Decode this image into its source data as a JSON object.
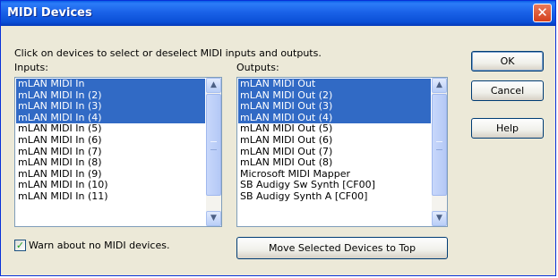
{
  "window": {
    "title": "MIDI Devices",
    "close_glyph": "✕",
    "instruction": "Click on devices to select or deselect MIDI inputs and outputs."
  },
  "inputs": {
    "label": "Inputs:",
    "items": [
      {
        "label": "mLAN MIDI In",
        "selected": true
      },
      {
        "label": "mLAN MIDI In (2)",
        "selected": true
      },
      {
        "label": "mLAN MIDI In (3)",
        "selected": true
      },
      {
        "label": "mLAN MIDI In (4)",
        "selected": true
      },
      {
        "label": "mLAN MIDI In (5)",
        "selected": false
      },
      {
        "label": "mLAN MIDI In (6)",
        "selected": false
      },
      {
        "label": "mLAN MIDI In (7)",
        "selected": false
      },
      {
        "label": "mLAN MIDI In (8)",
        "selected": false
      },
      {
        "label": "mLAN MIDI In (9)",
        "selected": false
      },
      {
        "label": "mLAN MIDI In (10)",
        "selected": false
      },
      {
        "label": "mLAN MIDI In (11)",
        "selected": false
      }
    ]
  },
  "outputs": {
    "label": "Outputs:",
    "items": [
      {
        "label": "mLAN MIDI Out",
        "selected": true
      },
      {
        "label": "mLAN MIDI Out (2)",
        "selected": true
      },
      {
        "label": "mLAN MIDI Out (3)",
        "selected": true
      },
      {
        "label": "mLAN MIDI Out (4)",
        "selected": true
      },
      {
        "label": "mLAN MIDI Out (5)",
        "selected": false
      },
      {
        "label": "mLAN MIDI Out (6)",
        "selected": false
      },
      {
        "label": "mLAN MIDI Out (7)",
        "selected": false
      },
      {
        "label": "mLAN MIDI Out (8)",
        "selected": false
      },
      {
        "label": "Microsoft MIDI Mapper",
        "selected": false
      },
      {
        "label": "SB Audigy Sw Synth [CF00]",
        "selected": false
      },
      {
        "label": "SB Audigy Synth A [CF00]",
        "selected": false
      }
    ]
  },
  "buttons": {
    "ok": "OK",
    "cancel": "Cancel",
    "help": "Help",
    "move_to_top": "Move Selected Devices to Top"
  },
  "warn_checkbox": {
    "label": "Warn about no MIDI devices.",
    "checked": true
  },
  "icons": {
    "scroll_up": "▲",
    "scroll_down": "▼",
    "check": "✓"
  },
  "colors": {
    "selection": "#316ac5",
    "titlebar": "#0a4fd6",
    "dialog_bg": "#ece9d8"
  }
}
